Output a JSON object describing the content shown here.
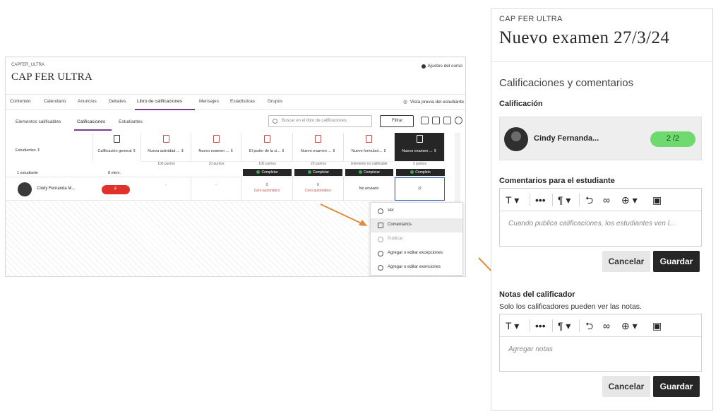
{
  "gradebook": {
    "course_code": "CAPFER_ULTRA",
    "course_title": "CAP FER ULTRA",
    "settings_label": "Ajustes del curso",
    "nav": [
      "Contenido",
      "Calendario",
      "Anuncios",
      "Debates",
      "Libro de calificaciones",
      "Mensajes",
      "Estadísticas",
      "Grupos"
    ],
    "preview_label": "Vista previa del estudiante",
    "subtabs": [
      "Elementos calificables",
      "Calificaciones",
      "Estudiantes"
    ],
    "search_placeholder": "Buscar en el libro de calificaciones",
    "filter_label": "Filtrar",
    "students_header": "Estudiantes ⇕",
    "overall_header": "Calificación general ⇕",
    "columns": [
      {
        "label": "Nueva actividad ... ⇕",
        "points": "100 puntos"
      },
      {
        "label": "Nuevo examen ... ⇕",
        "points": "10 puntos"
      },
      {
        "label": "El poder de la ci... ⇕",
        "points": "100 puntos"
      },
      {
        "label": "Nuevo examen ... ⇕",
        "points": "20 puntos"
      },
      {
        "label": "Nuevo formulari... ⇕",
        "points": "Elemento no calificable"
      },
      {
        "label": "Nuevo examen ... ⇕",
        "points": "2 puntos"
      }
    ],
    "status_label": "Completar",
    "status_label_last": "Completo",
    "count_label": "1 estudiante",
    "overall_sub": "8 elem.",
    "student_name": "Cindy Fernanda M...",
    "student_overall": "F",
    "cells": [
      {
        "value": "-",
        "note": ""
      },
      {
        "value": "-",
        "note": ""
      },
      {
        "value": "0",
        "note": "Cero automático"
      },
      {
        "value": "0",
        "note": "Cero automático"
      },
      {
        "value": "No enviado",
        "note": ""
      },
      {
        "value": "/2",
        "note": ""
      }
    ],
    "menu": [
      {
        "label": "Ver",
        "state": "normal"
      },
      {
        "label": "Comentarios",
        "state": "highlighted"
      },
      {
        "label": "Publicar",
        "state": "disabled"
      },
      {
        "label": "Agregar o editar excepciones",
        "state": "normal"
      },
      {
        "label": "Agregar o editar exenciones",
        "state": "normal"
      }
    ]
  },
  "panel": {
    "course_code": "CAP FER ULTRA",
    "title": "Nuevo examen 27/3/24",
    "section_title": "Calificaciones y comentarios",
    "grade_label": "Calificación",
    "student_name": "Cindy Fernanda...",
    "grade_value": "2",
    "grade_max": "/2",
    "comments_label": "Comentarios para el estudiante",
    "comments_placeholder": "Cuando publica calificaciones, los estudiantes ven l...",
    "notes_label": "Notas del calificador",
    "notes_help": "Solo los calificadores pueden ver las notas.",
    "notes_placeholder": "Agregar notas",
    "cancel_label": "Cancelar",
    "save_label": "Guardar"
  },
  "colors": {
    "accent": "#7a3d8f",
    "grade_pill": "#6dd96f",
    "fail_pill": "#e0322b",
    "arrow": "#e08a3c"
  }
}
